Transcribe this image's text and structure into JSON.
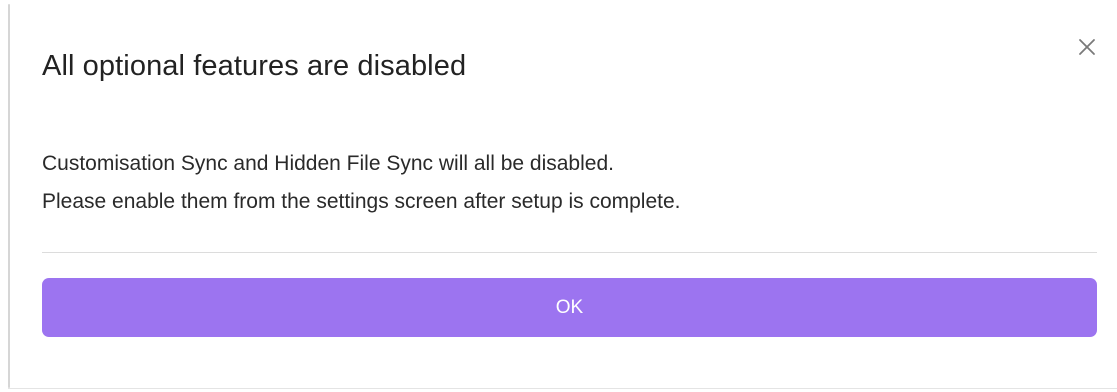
{
  "dialog": {
    "title": "All optional features are disabled",
    "message_line_1": "Customisation Sync and Hidden File Sync will all be disabled.",
    "message_line_2": "Please enable them from the settings screen after setup is complete.",
    "ok_label": "OK",
    "close_icon": "close-icon"
  },
  "colors": {
    "accent": "#9c74f0",
    "button_text": "#ffffff",
    "title_text": "#222222",
    "divider": "#dcdcdc"
  }
}
